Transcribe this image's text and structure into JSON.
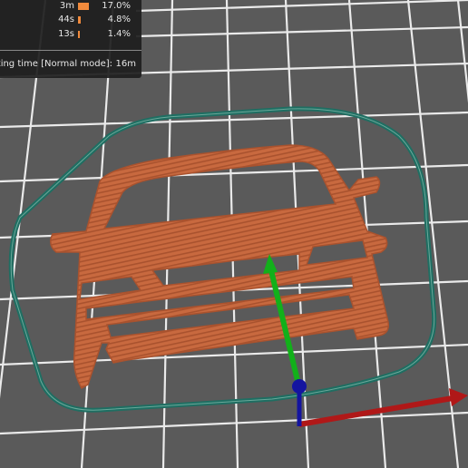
{
  "stats": {
    "rows": [
      {
        "time": "3m",
        "percent": "17.0%",
        "fraction": 0.17
      },
      {
        "time": "44s",
        "percent": "4.8%",
        "fraction": 0.048
      },
      {
        "time": "13s",
        "percent": "1.4%",
        "fraction": 0.014
      }
    ],
    "total_label": "Estimated printing time [Normal mode]:",
    "total_value": "16m"
  },
  "colors": {
    "bed": "#5a5a5a",
    "grid": "#eaeaea",
    "model_fill": "#c8693f",
    "model_stripe": "#a9522e",
    "skirt": "#1f6e62",
    "axis_x": "#b01818",
    "axis_y": "#12b01a",
    "axis_z": "#1414a0",
    "bar": "#f08a3c"
  },
  "icons": [
    "orange-bar",
    "axis-arrow-x",
    "axis-arrow-y",
    "axis-origin-z"
  ]
}
